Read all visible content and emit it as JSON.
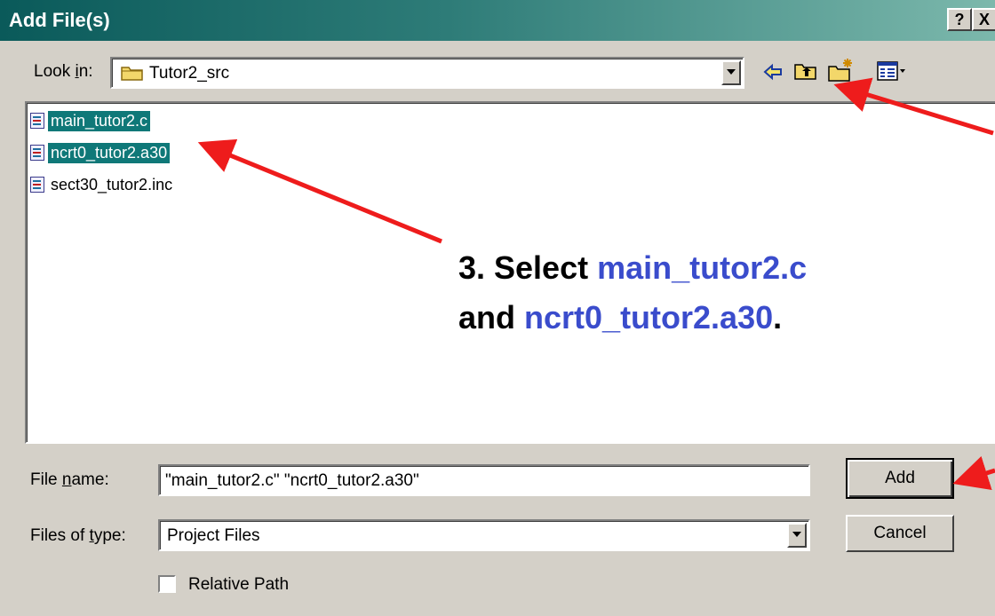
{
  "window": {
    "title": "Add File(s)",
    "help_label": "?",
    "close_label": "X"
  },
  "look_in": {
    "label_pre": "Look ",
    "label_u": "i",
    "label_post": "n:",
    "value": "Tutor2_src"
  },
  "files": [
    {
      "name": "main_tutor2.c",
      "selected": true
    },
    {
      "name": "ncrt0_tutor2.a30",
      "selected": true
    },
    {
      "name": "sect30_tutor2.inc",
      "selected": false
    }
  ],
  "annotation": {
    "line1_prefix": "3. Select ",
    "line1_file": "main_tutor2.c",
    "line2_prefix": "and ",
    "line2_file": "ncrt0_tutor2.a30",
    "line2_suffix": ".",
    "highlight_color": "#3a4ccc",
    "arrow_color": "#ee1c1c"
  },
  "file_name": {
    "label_pre": "File ",
    "label_u": "n",
    "label_post": "ame:",
    "value": "\"main_tutor2.c\" \"ncrt0_tutor2.a30\""
  },
  "file_type": {
    "label_pre": "Files of ",
    "label_u": "t",
    "label_post": "ype:",
    "value": "Project Files"
  },
  "buttons": {
    "add": "Add",
    "cancel": "Cancel"
  },
  "relative_path": {
    "label": "Relative Path",
    "checked": false
  },
  "icons": [
    "folder-icon",
    "back-arrow-icon",
    "up-folder-icon",
    "new-folder-icon",
    "view-menu-icon"
  ]
}
